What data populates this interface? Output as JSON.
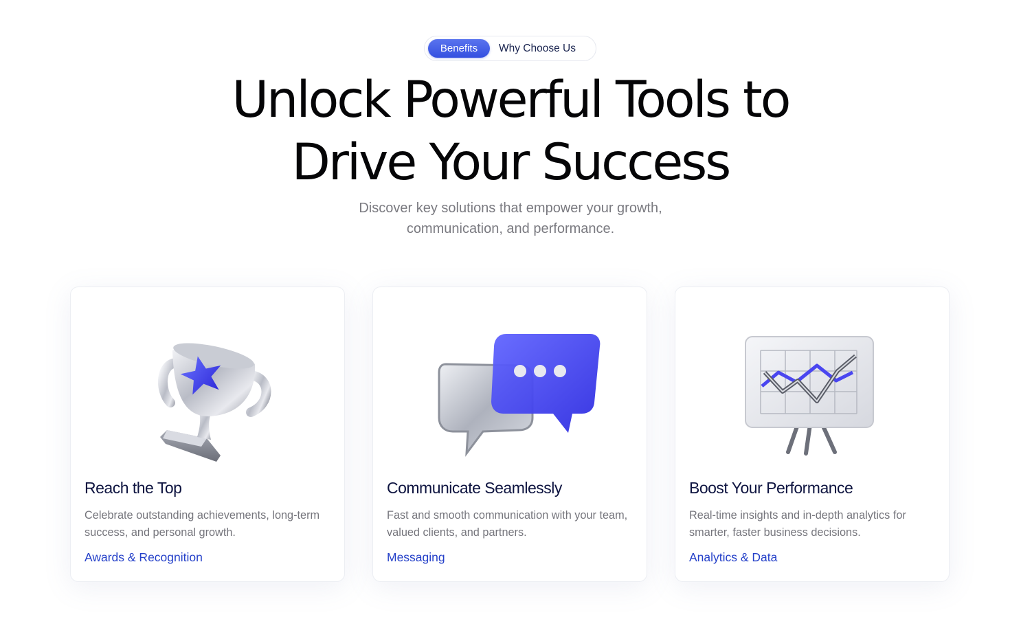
{
  "header": {
    "tabs": [
      {
        "label": "Benefits",
        "active": true
      },
      {
        "label": "Why Choose Us",
        "active": false
      }
    ],
    "title_line1": "Unlock Powerful Tools to",
    "title_line2": "Drive Your Success",
    "subtitle_line1": "Discover key solutions that empower your growth,",
    "subtitle_line2": "communication, and performance."
  },
  "cards": [
    {
      "icon": "trophy-icon",
      "title": "Reach the Top",
      "description": "Celebrate outstanding achievements, long-term success, and personal growth.",
      "link": "Awards & Recognition"
    },
    {
      "icon": "chat-bubbles-icon",
      "title": "Communicate Seamlessly",
      "description": "Fast and smooth communication with your team, valued clients, and partners.",
      "link": "Messaging"
    },
    {
      "icon": "chart-board-icon",
      "title": "Boost Your Performance",
      "description": "Real-time insights and in-depth analytics for smarter, faster business decisions.",
      "link": "Analytics & Data"
    }
  ],
  "colors": {
    "accent": "#3450e0",
    "link": "#2440c9",
    "title": "#0e1440",
    "text_muted": "#75757c"
  }
}
